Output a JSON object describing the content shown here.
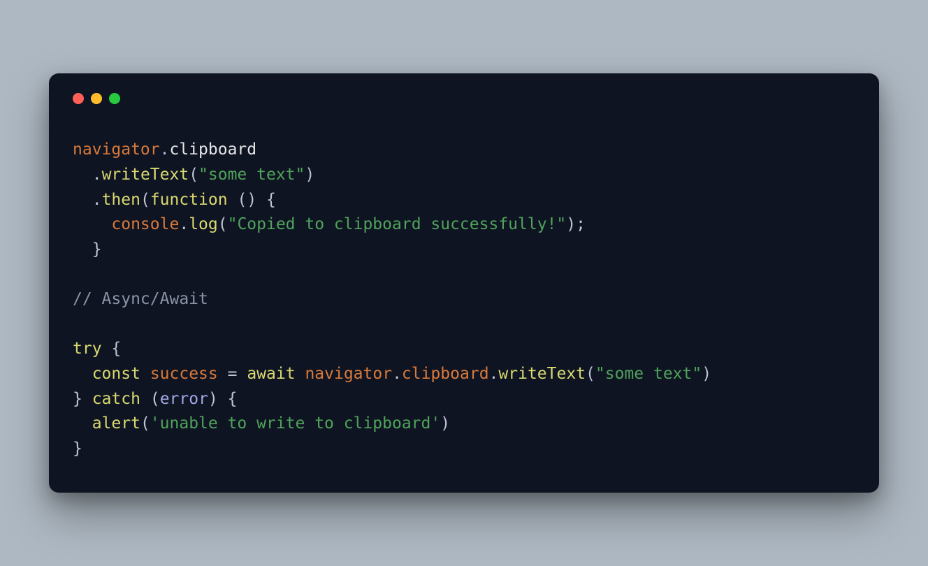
{
  "code": {
    "tokens": {
      "navigator": "navigator",
      "clipboard": "clipboard",
      "writeText": "writeText",
      "then": "then",
      "function": "function",
      "console": "console",
      "log": "log",
      "string_some_text_dq": "\"some text\"",
      "string_copied": "\"Copied to clipboard successfully!\"",
      "comment_async": "// Async/Await",
      "try": "try",
      "const": "const",
      "success": "success",
      "equals": "=",
      "await": "await",
      "catch": "catch",
      "error": "error",
      "alert": "alert",
      "string_unable": "'unable to write to clipboard'",
      "dot": ".",
      "lparen": "(",
      "rparen": ")",
      "lbrace": "{",
      "rbrace": "}",
      "semi": ";",
      "space": " ",
      "indent2": "  ",
      "indent4": "    "
    }
  },
  "window": {
    "close": "close",
    "minimize": "minimize",
    "zoom": "zoom"
  }
}
